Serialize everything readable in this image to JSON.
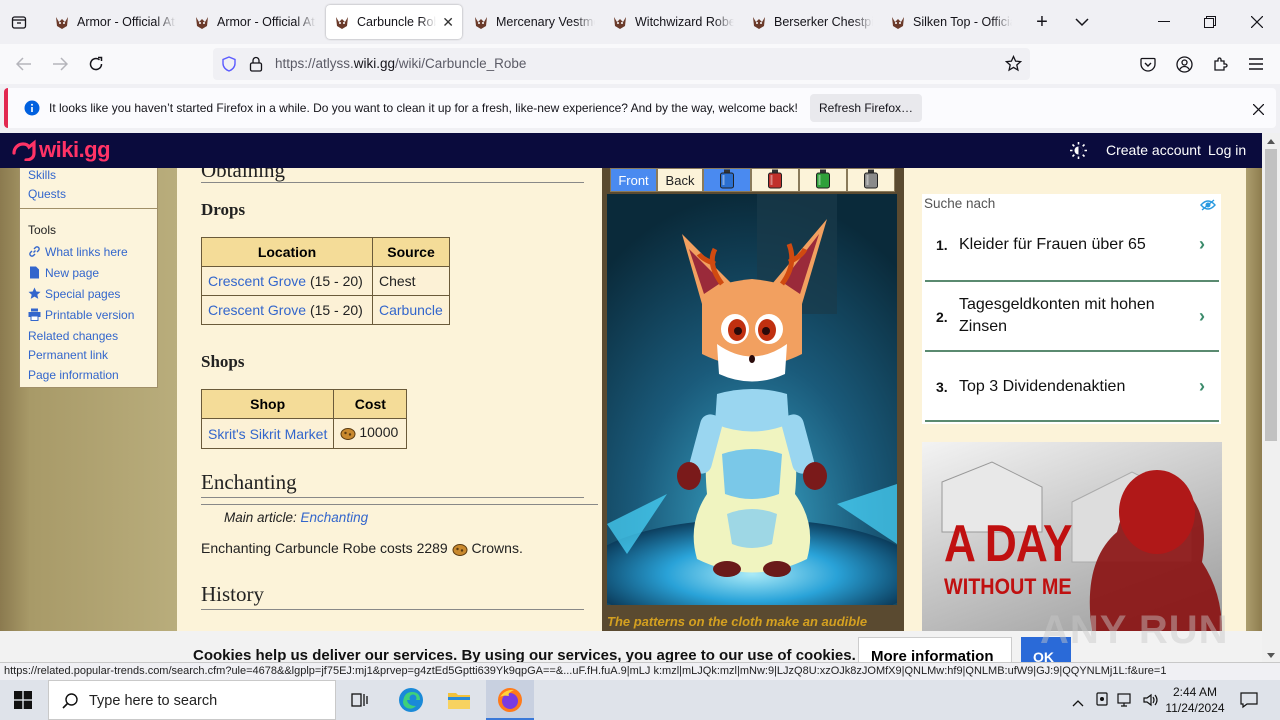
{
  "browser": {
    "tabs": [
      {
        "label": "Armor - Official Atlyss Wiki",
        "active": false
      },
      {
        "label": "Armor - Official Atlyss Wiki",
        "active": false
      },
      {
        "label": "Carbuncle Robe - Official Atlyss Wiki",
        "active": true
      },
      {
        "label": "Mercenary Vestment - Official Atlyss Wiki",
        "active": false
      },
      {
        "label": "Witchwizard Robe - Official Atlyss Wiki",
        "active": false
      },
      {
        "label": "Berserker Chestpiece - Official Atlyss Wiki",
        "active": false
      },
      {
        "label": "Silken Top - Official Atlyss Wiki",
        "active": false
      }
    ],
    "url_prefix": "https://atlyss.",
    "url_domain": "wiki.gg",
    "url_path": "/wiki/Carbuncle_Robe",
    "notification": "It looks like you haven’t started Firefox in a while. Do you want to clean it up for a fresh, like-new experience? And by the way, welcome back!",
    "refresh_label": "Refresh Firefox…",
    "status_url": "https://related.popular-trends.com/search.cfm?ule=4678&&lgplp=jf75EJ:mj1&prvep=g4ztEd5Gptti639Yk9qpGA==&...uF.fH.fuA.9|mLJ k:mzl|mLJQk:mzl|mNw:9|LJzQ8U:xzOJk8zJOMfX9|QNLMw:hf9|QNLMB:ufW9|GJ:9|QQYNLMj1L:f&ure=1"
  },
  "site": {
    "logo": "wiki.gg",
    "create_account": "Create account",
    "login": "Log in"
  },
  "sidebar": {
    "links_top": [
      "Skills",
      "Quests"
    ],
    "tools_heading": "Tools",
    "tools": [
      {
        "label": "What links here",
        "icon": "link-icon"
      },
      {
        "label": "New page",
        "icon": "page-icon"
      },
      {
        "label": "Special pages",
        "icon": "star-icon"
      },
      {
        "label": "Printable version",
        "icon": "printer-icon"
      },
      {
        "label": "Related changes",
        "icon": ""
      },
      {
        "label": "Permanent link",
        "icon": ""
      },
      {
        "label": "Page information",
        "icon": ""
      }
    ]
  },
  "article": {
    "obtaining_heading": "Obtaining",
    "drops_heading": "Drops",
    "drops_table": {
      "headers": [
        "Location",
        "Source"
      ],
      "rows": [
        {
          "location": "Crescent Grove",
          "level": "(15 - 20)",
          "source": "Chest",
          "source_link": false
        },
        {
          "location": "Crescent Grove",
          "level": "(15 - 20)",
          "source": "Carbuncle",
          "source_link": true
        }
      ]
    },
    "shops_heading": "Shops",
    "shops_table": {
      "headers": [
        "Shop",
        "Cost"
      ],
      "rows": [
        {
          "shop": "Skrit's Sikrit Market",
          "cost": "10000"
        }
      ]
    },
    "enchanting_heading": "Enchanting",
    "main_article_prefix": "Main article: ",
    "main_article_link": "Enchanting",
    "enchant_text_before": "Enchanting Carbuncle Robe costs 2289",
    "enchant_text_after": "Crowns.",
    "history_heading": "History"
  },
  "infobox": {
    "tabs": [
      "Front",
      "Back"
    ],
    "swatch_colors": [
      "#2b6fd0",
      "#c0302a",
      "#2fa03a",
      "#8a8a8a"
    ],
    "caption": "The patterns on the cloth make an audible"
  },
  "ad": {
    "search_label": "Suche nach",
    "items": [
      {
        "num": "1.",
        "text": "Kleider für Frauen über 65"
      },
      {
        "num": "2.",
        "text": "Tagesgeldkonten mit hohen Zinsen"
      },
      {
        "num": "3.",
        "text": "Top 3 Dividendenaktien"
      }
    ],
    "banner_line1": "A DAY",
    "banner_line2": "WITHOUT ME"
  },
  "cookie": {
    "text": "Cookies help us deliver our services. By using our services, you agree to our use of cookies.",
    "more_info": "More information",
    "ok": "OK"
  },
  "taskbar": {
    "search_placeholder": "Type here to search",
    "time": "2:44 AM",
    "date": "11/24/2024"
  },
  "watermark": "ANY RUN"
}
